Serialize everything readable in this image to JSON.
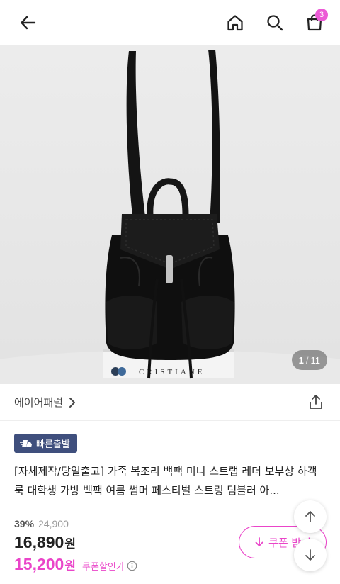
{
  "header": {
    "back_icon": "arrow-left-icon",
    "home_icon": "home-icon",
    "search_icon": "search-icon",
    "cart_icon": "shopping-bag-icon",
    "cart_count": "3"
  },
  "gallery": {
    "current": "1",
    "separator": "/",
    "total": "11",
    "banner_text": "CRISTIANE"
  },
  "brand": {
    "name": "에이어패럴",
    "share_icon": "share-icon"
  },
  "badge": {
    "label": "빠른출발"
  },
  "product": {
    "title": "[자체제작/당일출고] 가죽 복조리 백팩 미니 스트랩 레더 보부상 하객룩 대학생 가방 백팩 여름 썸머 페스티벌 스트링 텀블러 아..."
  },
  "price": {
    "discount_rate": "39%",
    "original": "24,900",
    "sale": "16,890",
    "unit": "원",
    "coupon_price": "15,200",
    "coupon_label": "쿠폰할인가"
  },
  "coupon_button": {
    "label": "쿠폰 받기"
  },
  "colors": {
    "accent": "#ea44c9",
    "badge_bg": "#3f4f7d",
    "cart_badge": "#ec5ad6"
  }
}
